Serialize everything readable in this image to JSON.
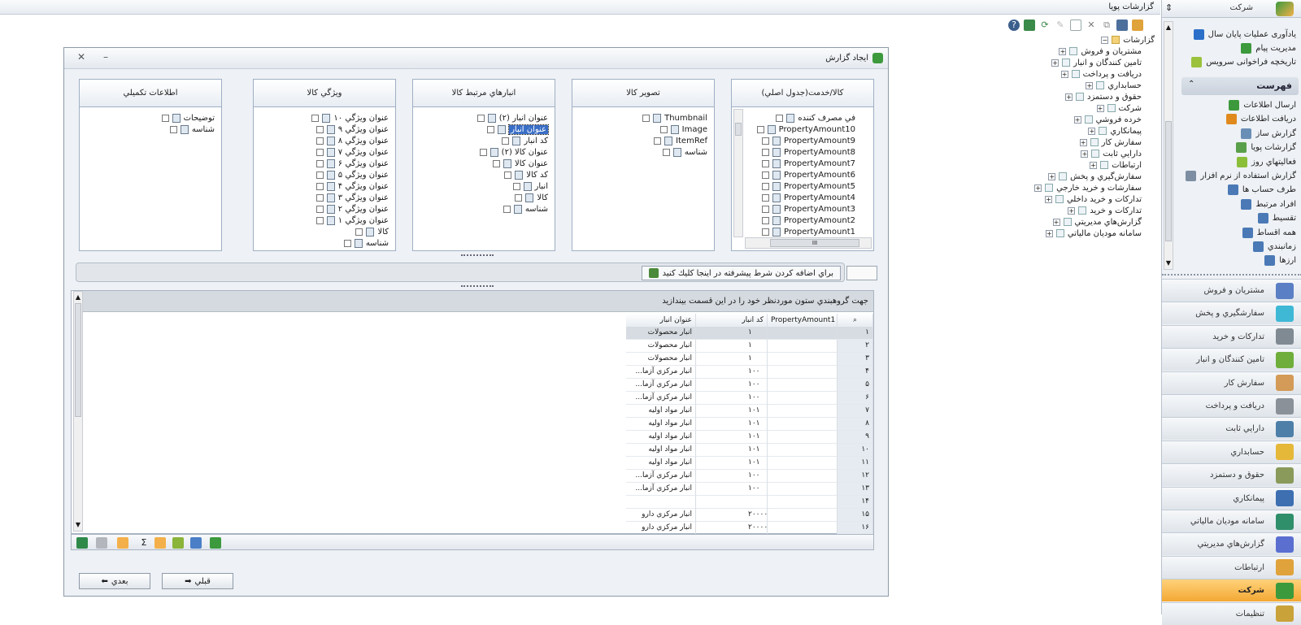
{
  "window": {
    "title": "گزارشات پویا"
  },
  "sidebar": {
    "company": "شرکت",
    "top_items": [
      {
        "label": "يادآوری عمليات پايان سال",
        "icon": "reminder-icon",
        "color": "#2b6fc9"
      },
      {
        "label": "مديريت پيام",
        "icon": "message-icon",
        "color": "#3c9a3c"
      },
      {
        "label": "تاريخچه فراخوانی سرويس",
        "icon": "history-icon",
        "color": "#9ac23c"
      }
    ],
    "list_title": "فهرست",
    "list_items": [
      {
        "label": "ارسال اطلاعات",
        "icon": "send-icon",
        "color": "#3c9a3c"
      },
      {
        "label": "دريافت اطلاعات",
        "icon": "receive-icon",
        "color": "#e08a1e"
      },
      {
        "label": "گزارش ساز",
        "icon": "report-builder-icon",
        "color": "#6a8fb6"
      },
      {
        "label": "گزارشات پويا",
        "icon": "dynamic-report-icon",
        "color": "#5aa04a"
      },
      {
        "label": "فعاليتهاي روز",
        "icon": "daily-activity-icon",
        "color": "#8bbf3a"
      },
      {
        "label": "گزارش استفاده از نرم افزار",
        "icon": "usage-report-icon",
        "color": "#7d8ea3"
      },
      {
        "label": "طرف حساب ها",
        "icon": "accounts-icon",
        "color": "#4a79b6"
      },
      {
        "label": "افراد مرتبط",
        "icon": "people-icon",
        "color": "#4a79b6"
      },
      {
        "label": "تقسيط",
        "icon": "installment-icon",
        "color": "#4a79b6"
      },
      {
        "label": "همه اقساط",
        "icon": "all-installments-icon",
        "color": "#4a79b6"
      },
      {
        "label": "زمانبندي",
        "icon": "schedule-icon",
        "color": "#4a79b6"
      },
      {
        "label": "ارزها",
        "icon": "currency-icon",
        "color": "#4a79b6"
      }
    ],
    "modules": [
      {
        "label": "مشتريان و فروش",
        "color": "#5b7fc4",
        "active": false
      },
      {
        "label": "سفارشگيري و پخش",
        "color": "#3fb8d6",
        "active": false
      },
      {
        "label": "تداركات و خريد",
        "color": "#7f8a93",
        "active": false
      },
      {
        "label": "تامين كنندگان و انبار",
        "color": "#6fae3a",
        "active": false
      },
      {
        "label": "سفارش كار",
        "color": "#d39b57",
        "active": false
      },
      {
        "label": "دريافت و پرداخت",
        "color": "#8a9199",
        "active": false
      },
      {
        "label": "دارايي ثابت",
        "color": "#4e7fa8",
        "active": false
      },
      {
        "label": "حسابداري",
        "color": "#e6b83a",
        "active": false
      },
      {
        "label": "حقوق و دستمزد",
        "color": "#8a9a5b",
        "active": false
      },
      {
        "label": "پيمانكاري",
        "color": "#3d6fb1",
        "active": false
      },
      {
        "label": "سامانه موديان مالياتي",
        "color": "#2f8f6a",
        "active": false
      },
      {
        "label": "گزارش‌هاي مديريتي",
        "color": "#5b6fd0",
        "active": false
      },
      {
        "label": "ارتباطات",
        "color": "#e0a23a",
        "active": false
      },
      {
        "label": "شركت",
        "color": "#3c9a3c",
        "active": true
      },
      {
        "label": "تنظيمات",
        "color": "#c9a23a",
        "active": false
      }
    ]
  },
  "tree": {
    "root": "گزارشات",
    "items": [
      "مشتريان و فروش",
      "تامين كنندگان و انبار",
      "دريافت و پرداخت",
      "حسابداري",
      "حقوق و دستمزد",
      "شركت",
      "خرده فروشي",
      "پيمانكاري",
      "سفارش كار",
      "دارايي ثابت",
      "ارتباطات",
      "سفارش‌گيري و پخش",
      "سفارشات و خريد خارجي",
      "تداركات و خريد داخلي",
      "تداركات و خريد",
      "گزارش‌هاي مديريتي",
      "سامانه موديان مالياتي"
    ]
  },
  "dialog": {
    "title": "ايجاد گزارش",
    "panels": [
      {
        "header": "كالا/خدمت(جدول اصلي)",
        "items": [
          "في مصرف كننده",
          "PropertyAmount10",
          "PropertyAmount9",
          "PropertyAmount8",
          "PropertyAmount7",
          "PropertyAmount6",
          "PropertyAmount5",
          "PropertyAmount4",
          "PropertyAmount3",
          "PropertyAmount2",
          "PropertyAmount1"
        ],
        "hscroll": "III"
      },
      {
        "header": "تصوير كالا",
        "items": [
          "Thumbnail",
          "Image",
          "ItemRef",
          "شناسه"
        ]
      },
      {
        "header": "انبارهاي مرتبط كالا",
        "items": [
          "عنوان انبار (٢)",
          "عنوان انبار",
          "كد انبار",
          "عنوان كالا (٢)",
          "عنوان كالا",
          "كد كالا",
          "انبار",
          "كالا",
          "شناسه"
        ],
        "selected_index": 1
      },
      {
        "header": "ويژگي كالا",
        "items": [
          "عنوان ويژگي ١٠",
          "عنوان ويژگي ٩",
          "عنوان ويژگي ٨",
          "عنوان ويژگي ٧",
          "عنوان ويژگي ۶",
          "عنوان ويژگي ۵",
          "عنوان ويژگي ۴",
          "عنوان ويژگي ٣",
          "عنوان ويژگي ٢",
          "عنوان ويژگي ١",
          "كالا",
          "شناسه"
        ]
      },
      {
        "header": "اطلاعات تكميلي",
        "items": [
          "توضيحات",
          "شناسه"
        ]
      }
    ],
    "condition_label": "براي اضافه كردن شرط پيشرفته در اينجا كليك كنيد",
    "group_hint": "جهت گروهبندي ستون موردنظر خود را در اين قسمت بيندازيد",
    "grid": {
      "columns": [
        "عنوان انبار",
        "كد انبار",
        "PropertyAmount1"
      ],
      "rows": [
        {
          "n": "١",
          "name": "انبار محصولات",
          "code": "١",
          "amt": ""
        },
        {
          "n": "٢",
          "name": "انبار محصولات",
          "code": "١",
          "amt": ""
        },
        {
          "n": "٣",
          "name": "انبار محصولات",
          "code": "١",
          "amt": ""
        },
        {
          "n": "۴",
          "name": "انبار مركزي آزما...",
          "code": "١٠٠",
          "amt": ""
        },
        {
          "n": "۵",
          "name": "انبار مركزي آزما...",
          "code": "١٠٠",
          "amt": ""
        },
        {
          "n": "۶",
          "name": "انبار مركزي آزما...",
          "code": "١٠٠",
          "amt": ""
        },
        {
          "n": "٧",
          "name": "انبار مواد اوليه",
          "code": "١٠١",
          "amt": ""
        },
        {
          "n": "٨",
          "name": "انبار مواد اوليه",
          "code": "١٠١",
          "amt": ""
        },
        {
          "n": "٩",
          "name": "انبار مواد اوليه",
          "code": "١٠١",
          "amt": ""
        },
        {
          "n": "١٠",
          "name": "انبار مواد اوليه",
          "code": "١٠١",
          "amt": ""
        },
        {
          "n": "١١",
          "name": "انبار مواد اوليه",
          "code": "١٠١",
          "amt": ""
        },
        {
          "n": "١٢",
          "name": "انبار مركزي آزما...",
          "code": "١٠٠",
          "amt": ""
        },
        {
          "n": "١٣",
          "name": "انبار مركزي آزما...",
          "code": "١٠٠",
          "amt": ""
        },
        {
          "n": "١۴",
          "name": "",
          "code": "",
          "amt": ""
        },
        {
          "n": "١۵",
          "name": "انبار مركزي دارو",
          "code": "٢٠٠٠٠",
          "amt": ""
        },
        {
          "n": "١۶",
          "name": "انبار مركزي دارو",
          "code": "٢٠٠٠٠",
          "amt": ""
        }
      ],
      "selected_row": 0
    },
    "prev_label": "قبلي",
    "next_label": "بعدي"
  }
}
